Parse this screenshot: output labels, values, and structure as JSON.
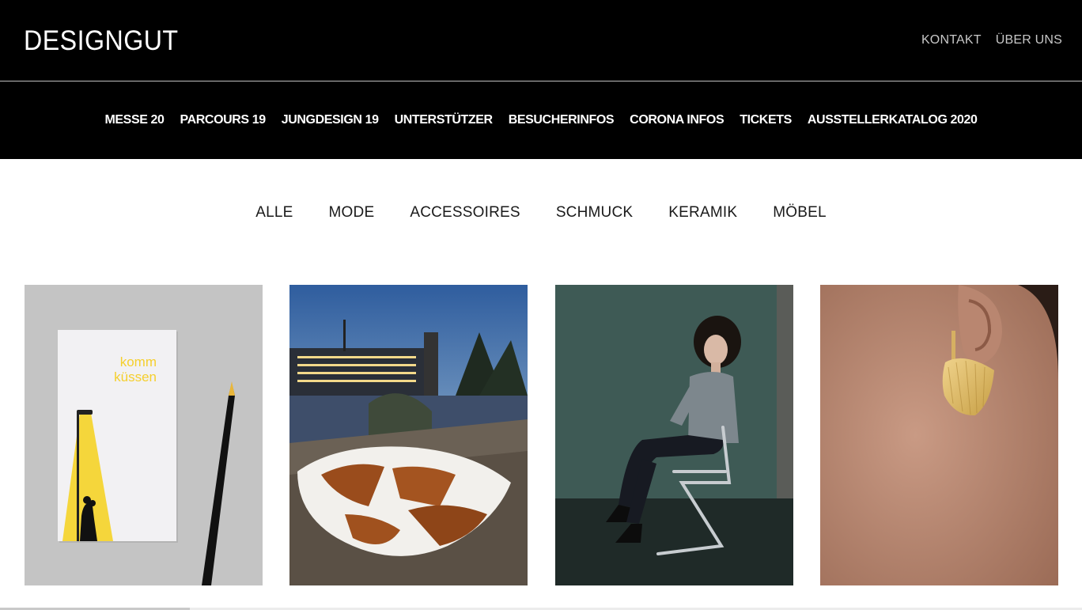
{
  "header": {
    "logo": "DESIGNGUT",
    "links": [
      "KONTAKT",
      "ÜBER UNS"
    ]
  },
  "nav": {
    "items": [
      "MESSE 20",
      "PARCOURS 19",
      "JUNGDESIGN 19",
      "UNTERSTÜTZER",
      "BESUCHERINFOS",
      "CORONA INFOS",
      "TICKETS",
      "AUSSTELLERKATALOG 2020"
    ]
  },
  "filters": {
    "items": [
      "ALLE",
      "MODE",
      "ACCESSOIRES",
      "SCHMUCK",
      "KERAMIK",
      "MÖBEL"
    ]
  },
  "gallery": {
    "card1": {
      "line1": "komm",
      "line2": "küssen"
    }
  },
  "colors": {
    "header_bg": "#000000",
    "accent_yellow": "#f5d63b",
    "text_dark": "#1a1a1a"
  }
}
